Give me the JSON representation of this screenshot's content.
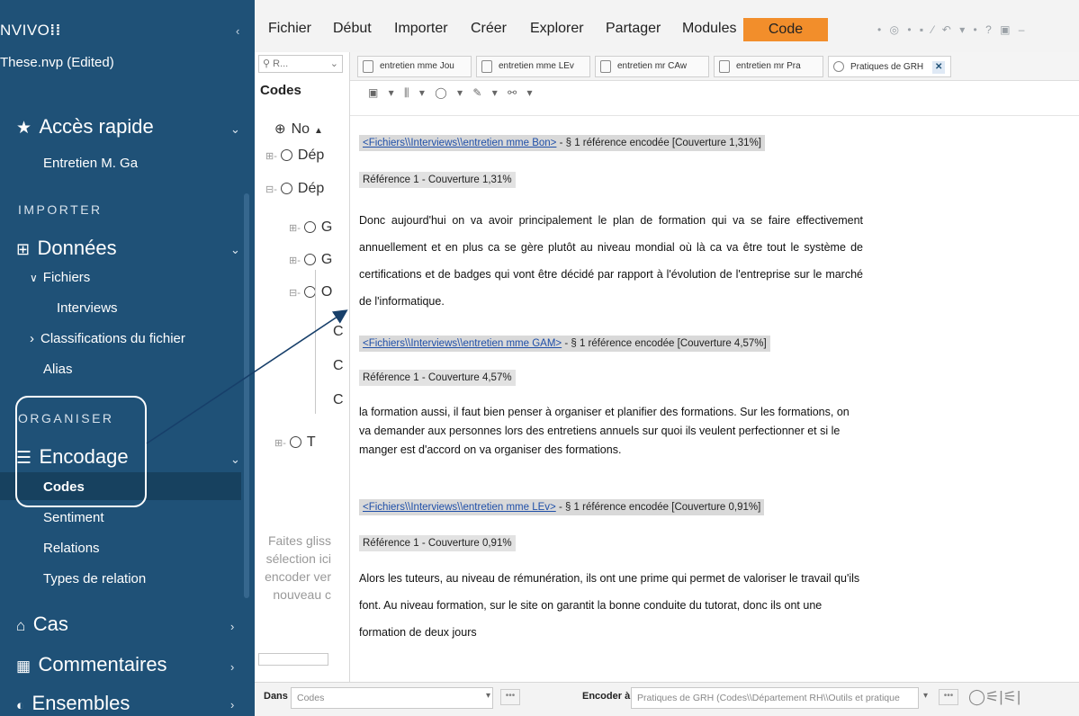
{
  "app": {
    "title": "NVIVO",
    "logo_symbol": "⁞⁞",
    "project": "These.nvp (Edited)",
    "collapse_symbol": "‹"
  },
  "sidebar": {
    "quick_access": {
      "label": "Accès rapide",
      "item": "Entretien M. Ga"
    },
    "import_section": "IMPORTER",
    "donnees": {
      "label": "Données",
      "fichiers": "Fichiers",
      "interviews": "Interviews",
      "classifications": "Classifications du fichier",
      "alias": "Alias"
    },
    "organize_section": "ORGANISER",
    "encodage": {
      "label": "Encodage",
      "codes": "Codes",
      "sentiment": "Sentiment",
      "relations": "Relations",
      "types_relation": "Types de relation"
    },
    "cas": "Cas",
    "commentaires": "Commentaires",
    "ensembles": "Ensembles"
  },
  "ribbon": {
    "menus": [
      "Fichier",
      "Début",
      "Importer",
      "Créer",
      "Explorer",
      "Partager",
      "Modules"
    ],
    "active": "Code",
    "quick_access_icons": "• ◎ • ▪ ⁄ ↶ ▾ • ? ▣ –"
  },
  "codes_pane": {
    "search": "R...",
    "title": "Codes",
    "nodes": [
      "No",
      "Dép",
      "Dép",
      "G",
      "G",
      "O",
      "C",
      "C",
      "C",
      "T"
    ],
    "drop_hint": "Faites gliss sélection ici encoder ver nouveau c"
  },
  "tabs": [
    {
      "label": "entretien mme Jou"
    },
    {
      "label": "entretien mme LEv"
    },
    {
      "label": "entretien mr CAw"
    },
    {
      "label": "entretien mr Pra"
    },
    {
      "label": "Pratiques de GRH"
    }
  ],
  "tab_close": "✕",
  "doc_toolbar": "▣ ▾  ⫼ ▾  ◯ ▾  ✎ ▾  ⚯ ▾",
  "content": [
    {
      "link": "<Fichiers\\\\Interviews\\\\entretien mme Bon>",
      "info": " - § 1 référence encodée  [Couverture 1,31%]",
      "ref": "Référence 1 - Couverture 1,31%",
      "text": "Donc aujourd'hui on va avoir principalement le plan de formation qui va se faire effectivement annuellement et en plus ca se gère plutôt au niveau mondial où là ca va être tout le système de certifications et de badges qui vont être décidé par rapport à l'évolution de l'entreprise sur le marché de l'informatique."
    },
    {
      "link": "<Fichiers\\\\Interviews\\\\entretien mme GAM>",
      "info": " - § 1 référence encodée  [Couverture 4,57%]",
      "ref": "Référence 1 - Couverture 4,57%",
      "text": "la formation aussi, il faut bien penser à organiser et planifier des formations. Sur les formations, on va demander aux personnes lors des entretiens annuels sur quoi ils veulent perfectionner et si le manger est d'accord on va organiser des formations."
    },
    {
      "link": "<Fichiers\\\\Interviews\\\\entretien mme LEv>",
      "info": " - § 1 référence encodée  [Couverture 0,91%]",
      "ref": "Référence 1 - Couverture 0,91%",
      "text": "Alors les tuteurs, au niveau de rémunération, ils ont une prime qui permet de valoriser le travail qu'ils font. Au niveau formation, sur le site on garantit la bonne conduite du tutorat, donc ils ont une formation de deux jours"
    }
  ],
  "bottom": {
    "dans_label": "Dans",
    "dans_value": "Codes",
    "encoder_label": "Encoder à",
    "encoder_value": "Pratiques de GRH (Codes\\\\Département RH\\\\Outils et pratique",
    "dots": "•••",
    "icons": "◯⚟|⚟|"
  },
  "colors": {
    "sidebar": "#1f5177",
    "accent": "#f28e2b",
    "link": "#1f4fa8",
    "arrow": "#173f6a"
  }
}
